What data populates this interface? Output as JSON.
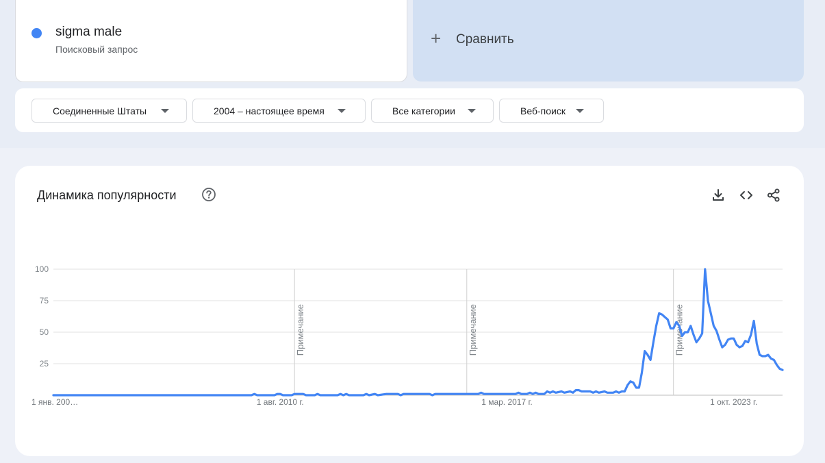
{
  "search_term": {
    "name": "sigma male",
    "type": "Поисковый запрос",
    "color": "#4285f4"
  },
  "compare": {
    "icon": "plus-icon",
    "plus_glyph": "+",
    "label": "Сравнить"
  },
  "filters": [
    {
      "label": "Соединенные Штаты"
    },
    {
      "label": "2004 – настоящее время"
    },
    {
      "label": "Все категории"
    },
    {
      "label": "Веб-поиск"
    }
  ],
  "trend": {
    "title": "Динамика популярности",
    "icons": [
      "help-icon",
      "download-icon",
      "embed-icon",
      "share-icon"
    ]
  },
  "chart_data": {
    "type": "line",
    "title": "",
    "xlabel": "",
    "ylabel": "",
    "ylim": [
      0,
      100
    ],
    "yticks": [
      25,
      50,
      75,
      100
    ],
    "xtick_labels": [
      "1 янв. 200…",
      "1 авг. 2010 г.",
      "1 мар. 2017 г.",
      "1 окт. 2023 г."
    ],
    "annotation_label": "Примечание",
    "annotations": [
      "2011-01",
      "2016-01",
      "2022-01"
    ],
    "grid": true,
    "line_color": "#4285f4",
    "series": [
      {
        "points": [
          [
            "2004-01",
            0
          ],
          [
            "2009-10",
            0
          ],
          [
            "2009-11",
            1
          ],
          [
            "2009-12",
            0
          ],
          [
            "2010-06",
            0
          ],
          [
            "2010-07",
            1
          ],
          [
            "2010-08",
            1
          ],
          [
            "2010-09",
            0
          ],
          [
            "2010-12",
            0
          ],
          [
            "2011-01",
            1
          ],
          [
            "2011-04",
            1
          ],
          [
            "2011-05",
            0
          ],
          [
            "2011-08",
            0
          ],
          [
            "2011-09",
            1
          ],
          [
            "2011-10",
            0
          ],
          [
            "2012-04",
            0
          ],
          [
            "2012-05",
            1
          ],
          [
            "2012-06",
            0
          ],
          [
            "2012-07",
            1
          ],
          [
            "2012-08",
            0
          ],
          [
            "2013-01",
            0
          ],
          [
            "2013-02",
            1
          ],
          [
            "2013-03",
            0
          ],
          [
            "2013-05",
            1
          ],
          [
            "2013-06",
            0
          ],
          [
            "2013-09",
            1
          ],
          [
            "2013-10",
            1
          ],
          [
            "2014-01",
            1
          ],
          [
            "2014-02",
            0
          ],
          [
            "2014-03",
            1
          ],
          [
            "2014-12",
            1
          ],
          [
            "2015-01",
            0
          ],
          [
            "2015-02",
            1
          ],
          [
            "2016-05",
            1
          ],
          [
            "2016-06",
            2
          ],
          [
            "2016-07",
            1
          ],
          [
            "2017-06",
            1
          ],
          [
            "2017-07",
            2
          ],
          [
            "2017-08",
            1
          ],
          [
            "2017-10",
            1
          ],
          [
            "2017-11",
            2
          ],
          [
            "2017-12",
            1
          ],
          [
            "2018-01",
            2
          ],
          [
            "2018-02",
            1
          ],
          [
            "2018-04",
            1
          ],
          [
            "2018-05",
            3
          ],
          [
            "2018-06",
            2
          ],
          [
            "2018-07",
            3
          ],
          [
            "2018-08",
            2
          ],
          [
            "2018-10",
            3
          ],
          [
            "2018-11",
            2
          ],
          [
            "2019-01",
            3
          ],
          [
            "2019-02",
            2
          ],
          [
            "2019-03",
            4
          ],
          [
            "2019-04",
            4
          ],
          [
            "2019-05",
            3
          ],
          [
            "2019-07",
            3
          ],
          [
            "2019-08",
            3
          ],
          [
            "2019-09",
            2
          ],
          [
            "2019-10",
            3
          ],
          [
            "2019-11",
            2
          ],
          [
            "2020-01",
            3
          ],
          [
            "2020-02",
            2
          ],
          [
            "2020-04",
            2
          ],
          [
            "2020-05",
            3
          ],
          [
            "2020-06",
            2
          ],
          [
            "2020-07",
            3
          ],
          [
            "2020-08",
            3
          ],
          [
            "2020-09",
            8
          ],
          [
            "2020-10",
            11
          ],
          [
            "2020-11",
            10
          ],
          [
            "2020-12",
            6
          ],
          [
            "2021-01",
            6
          ],
          [
            "2021-02",
            18
          ],
          [
            "2021-03",
            35
          ],
          [
            "2021-04",
            32
          ],
          [
            "2021-05",
            28
          ],
          [
            "2021-06",
            42
          ],
          [
            "2021-07",
            55
          ],
          [
            "2021-08",
            65
          ],
          [
            "2021-09",
            64
          ],
          [
            "2021-10",
            62
          ],
          [
            "2021-11",
            60
          ],
          [
            "2021-12",
            53
          ],
          [
            "2022-01",
            53
          ],
          [
            "2022-02",
            58
          ],
          [
            "2022-03",
            55
          ],
          [
            "2022-04",
            47
          ],
          [
            "2022-05",
            50
          ],
          [
            "2022-06",
            50
          ],
          [
            "2022-07",
            55
          ],
          [
            "2022-08",
            48
          ],
          [
            "2022-09",
            42
          ],
          [
            "2022-10",
            45
          ],
          [
            "2022-11",
            49
          ],
          [
            "2022-12",
            100
          ],
          [
            "2023-01",
            75
          ],
          [
            "2023-02",
            65
          ],
          [
            "2023-03",
            55
          ],
          [
            "2023-04",
            51
          ],
          [
            "2023-05",
            44
          ],
          [
            "2023-06",
            38
          ],
          [
            "2023-07",
            40
          ],
          [
            "2023-08",
            44
          ],
          [
            "2023-09",
            45
          ],
          [
            "2023-10",
            45
          ],
          [
            "2023-11",
            40
          ],
          [
            "2023-12",
            38
          ],
          [
            "2024-01",
            39
          ],
          [
            "2024-02",
            43
          ],
          [
            "2024-03",
            42
          ],
          [
            "2024-04",
            48
          ],
          [
            "2024-05",
            59
          ],
          [
            "2024-06",
            41
          ],
          [
            "2024-07",
            32
          ],
          [
            "2024-08",
            31
          ],
          [
            "2024-09",
            31
          ],
          [
            "2024-10",
            32
          ],
          [
            "2024-11",
            29
          ],
          [
            "2024-12",
            28
          ],
          [
            "2025-01",
            24
          ],
          [
            "2025-02",
            21
          ],
          [
            "2025-03",
            20
          ]
        ]
      }
    ]
  }
}
